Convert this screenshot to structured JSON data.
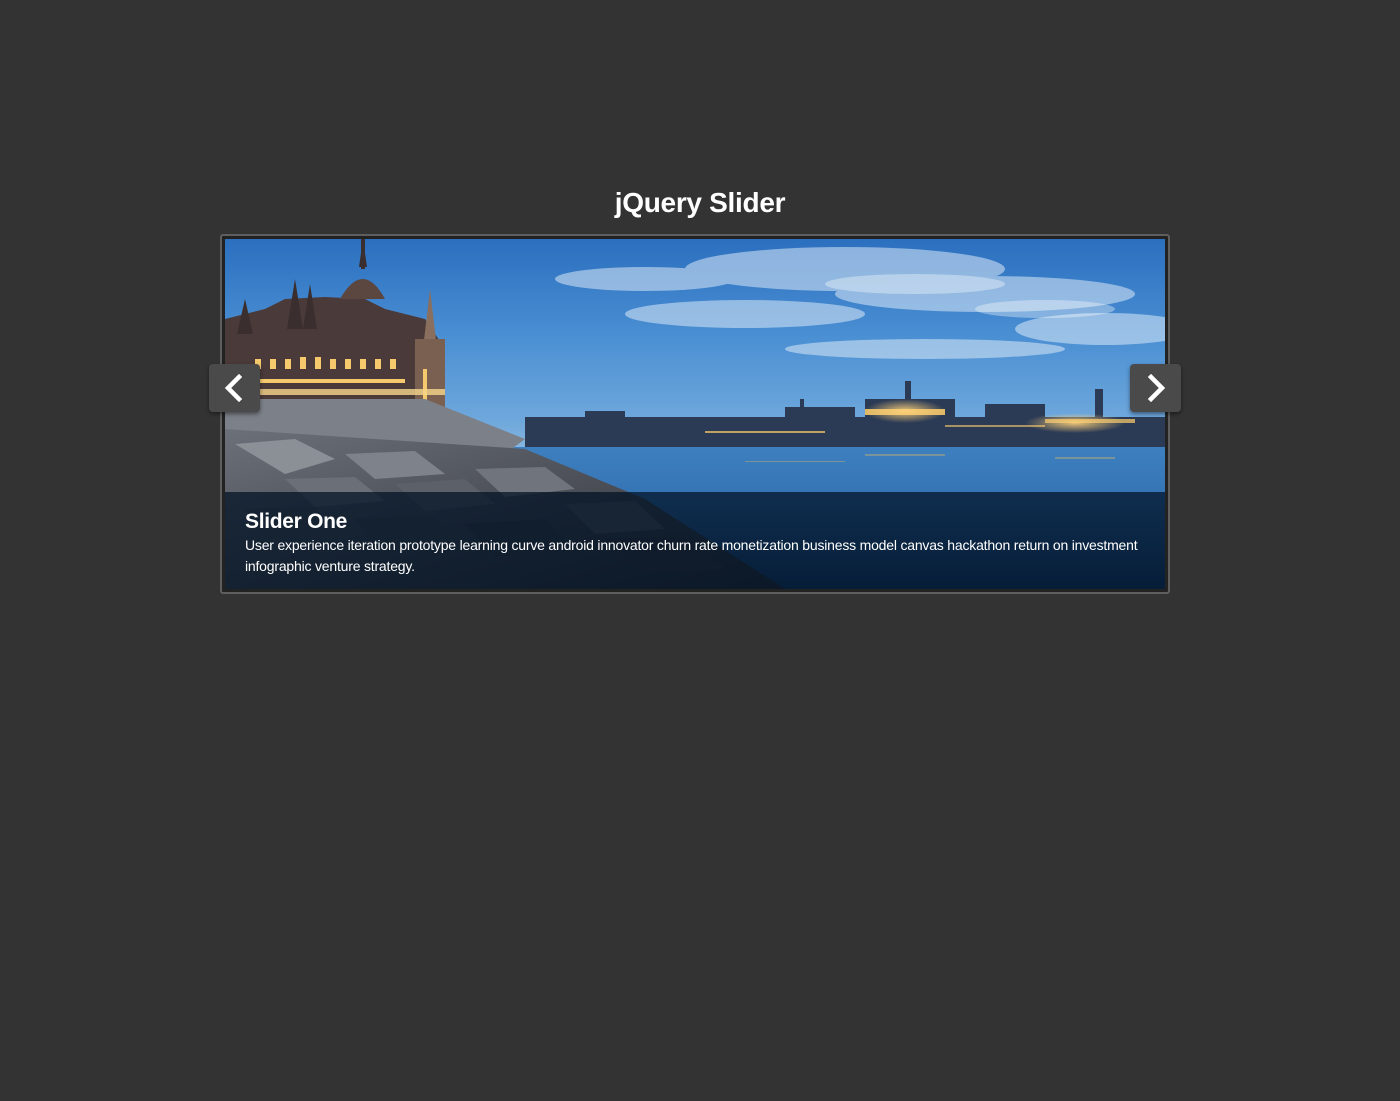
{
  "page": {
    "title": "jQuery Slider"
  },
  "slider": {
    "current_slide": {
      "title": "Slider One",
      "description": "User experience iteration prototype learning curve android innovator churn rate monetization business model canvas hackathon return on investment infographic venture strategy."
    },
    "prev_icon": "chevron-left-icon",
    "next_icon": "chevron-right-icon"
  },
  "colors": {
    "background": "#333333",
    "nav_button": "#4a4a4a",
    "caption_overlay": "#001024"
  }
}
